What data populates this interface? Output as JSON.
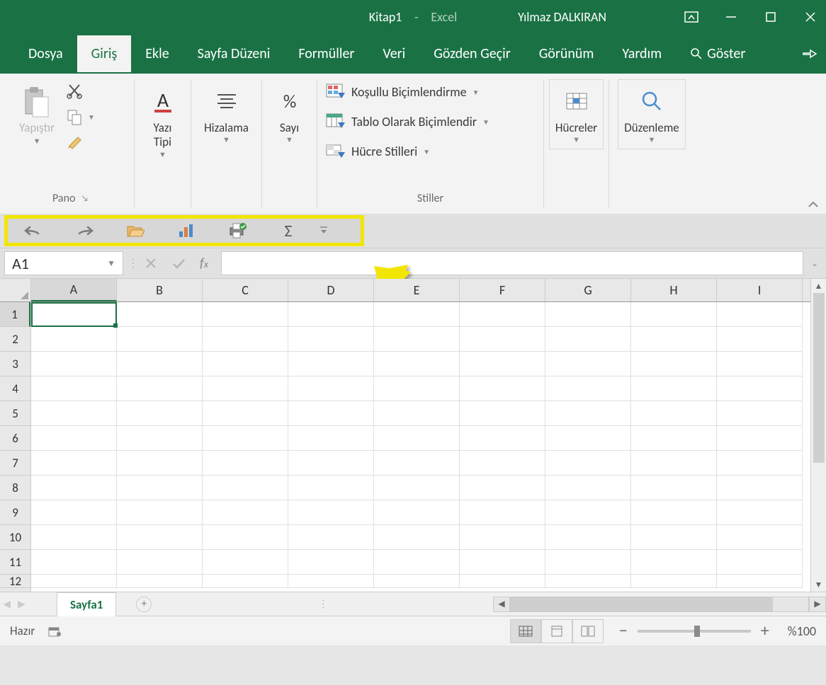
{
  "title": {
    "doc": "Kitap1",
    "sep": "-",
    "app": "Excel",
    "user": "Yılmaz DALKIRAN"
  },
  "tabs": [
    "Dosya",
    "Giriş",
    "Ekle",
    "Sayfa Düzeni",
    "Formüller",
    "Veri",
    "Gözden Geçir",
    "Görünüm",
    "Yardım"
  ],
  "active_tab": 1,
  "goster_label": "Göster",
  "ribbon": {
    "paste_label": "Yapıştır",
    "pano_label": "Pano",
    "font_label": "Yazı\nTipi",
    "align_label": "Hizalama",
    "number_label": "Sayı",
    "cond_format_label": "Koşullu Biçimlendirme",
    "table_format_label": "Tablo Olarak Biçimlendir",
    "cell_styles_label": "Hücre Stilleri",
    "styles_group_label": "Stiller",
    "cells_label": "Hücreler",
    "edit_label": "Düzenleme"
  },
  "qat_icons": [
    "undo",
    "redo",
    "open",
    "chart",
    "print",
    "autosum"
  ],
  "namebox_value": "A1",
  "formula_value": "",
  "columns": [
    "A",
    "B",
    "C",
    "D",
    "E",
    "F",
    "G",
    "H",
    "I"
  ],
  "rows": [
    1,
    2,
    3,
    4,
    5,
    6,
    7,
    8,
    9,
    10,
    11,
    12
  ],
  "active_cell": {
    "col": "A",
    "row": 1
  },
  "sheet_tab": "Sayfa1",
  "status_text": "Hazır",
  "zoom_label": "%100"
}
